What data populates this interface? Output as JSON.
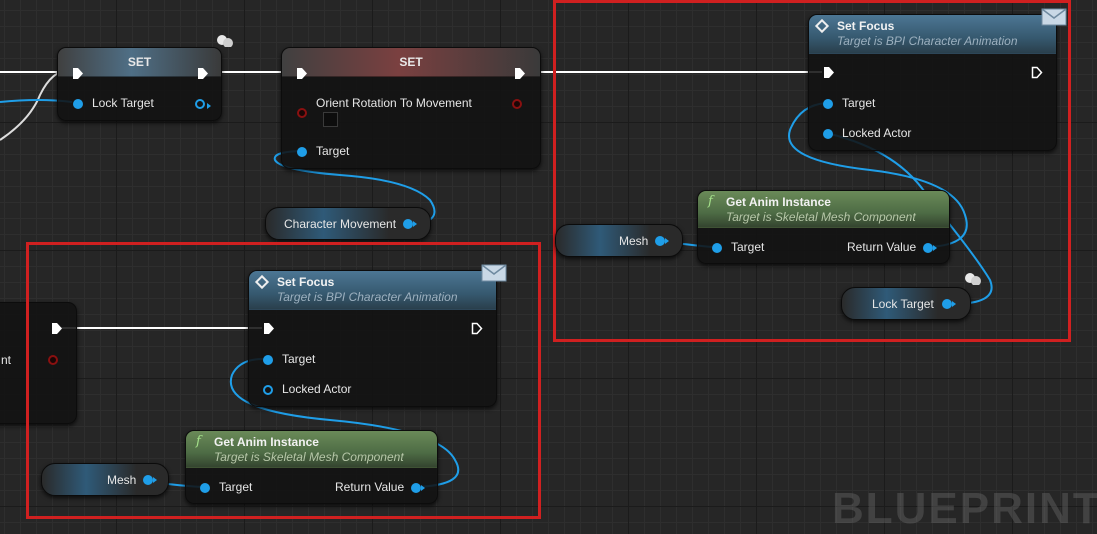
{
  "watermark": "BLUEPRINT",
  "set_lock_target": {
    "title": "SET",
    "pin_label": "Lock Target"
  },
  "set_orient": {
    "title": "SET",
    "pin_label": "Orient Rotation To Movement",
    "target_label": "Target"
  },
  "character_movement": {
    "label": "Character Movement"
  },
  "partial_node": {
    "label_fragment": "nt"
  },
  "top_right": {
    "set_focus": {
      "title": "Set Focus",
      "subtitle": "Target is BPI Character Animation",
      "target_label": "Target",
      "locked_actor_label": "Locked Actor"
    },
    "get_anim": {
      "title": "Get Anim Instance",
      "subtitle": "Target is Skeletal Mesh Component",
      "target_label": "Target",
      "return_label": "Return Value"
    },
    "mesh": {
      "label": "Mesh"
    },
    "lock_target": {
      "label": "Lock Target"
    }
  },
  "bottom_left": {
    "set_focus": {
      "title": "Set Focus",
      "subtitle": "Target is BPI Character Animation",
      "target_label": "Target",
      "locked_actor_label": "Locked Actor"
    },
    "get_anim": {
      "title": "Get Anim Instance",
      "subtitle": "Target is Skeletal Mesh Component",
      "target_label": "Target",
      "return_label": "Return Value"
    },
    "mesh": {
      "label": "Mesh"
    }
  },
  "icons": [
    "diamond-function-icon",
    "function-f-icon",
    "message-envelope-icon",
    "network-replicated-icon"
  ],
  "colors": {
    "object_pin": "#1f9ee8",
    "bool_pin": "#8a1010",
    "exec_wire": "#ffffff",
    "highlight": "#d02020"
  }
}
